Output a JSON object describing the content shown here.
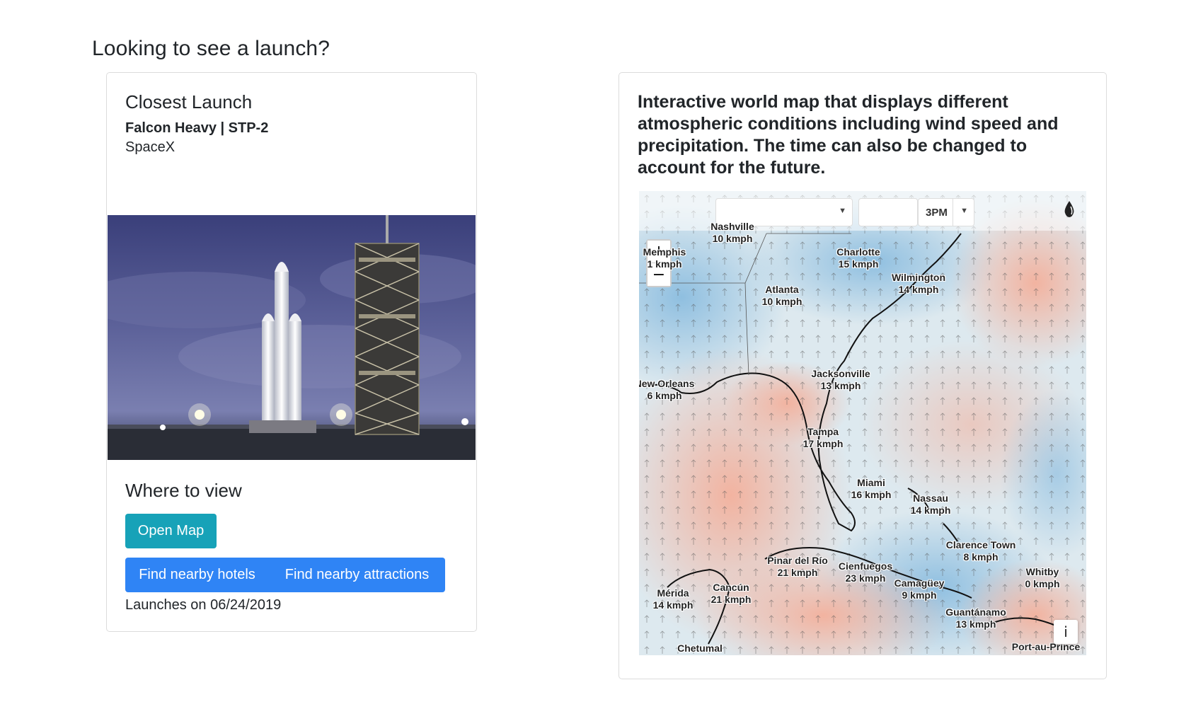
{
  "page": {
    "heading": "Looking to see a launch?"
  },
  "launch_card": {
    "title": "Closest Launch",
    "mission": "Falcon Heavy | STP-2",
    "provider": "SpaceX",
    "where_title": "Where to view",
    "open_map_label": "Open Map",
    "hotels_label": "Find nearby hotels",
    "attractions_label": "Find nearby attractions",
    "launch_date_text": "Launches on 06/24/2019"
  },
  "map_card": {
    "description": "Interactive world map that displays different atmospheric conditions including wind speed and precipitation. The time can also be changed to account for the future.",
    "time_select_value": "3PM",
    "layer_select_value": "",
    "level_select_value": "",
    "zoom_in_label": "+",
    "zoom_out_label": "−",
    "info_label": "i",
    "cities": [
      {
        "name": "Nashville",
        "speed": "10 kmph"
      },
      {
        "name": "Memphis",
        "speed": "1 kmph"
      },
      {
        "name": "Charlotte",
        "speed": "15 kmph"
      },
      {
        "name": "Atlanta",
        "speed": "10 kmph"
      },
      {
        "name": "Wilmington",
        "speed": "14 kmph"
      },
      {
        "name": "New Orleans",
        "speed": "6 kmph"
      },
      {
        "name": "Jacksonville",
        "speed": "13 kmph"
      },
      {
        "name": "Tampa",
        "speed": "17 kmph"
      },
      {
        "name": "Miami",
        "speed": "16 kmph"
      },
      {
        "name": "Nassau",
        "speed": "14 kmph"
      },
      {
        "name": "Clarence Town",
        "speed": "8 kmph"
      },
      {
        "name": "Whitby",
        "speed": "0 kmph"
      },
      {
        "name": "Pinar del Río",
        "speed": "21 kmph"
      },
      {
        "name": "Cienfuegos",
        "speed": "23 kmph"
      },
      {
        "name": "Camagüey",
        "speed": "9 kmph"
      },
      {
        "name": "Mérida",
        "speed": "14 kmph"
      },
      {
        "name": "Cancún",
        "speed": "21 kmph"
      },
      {
        "name": "Guantánamo",
        "speed": "13 kmph"
      },
      {
        "name": "Chetumal",
        "speed": ""
      },
      {
        "name": "Port-au-Prince",
        "speed": ""
      }
    ]
  }
}
